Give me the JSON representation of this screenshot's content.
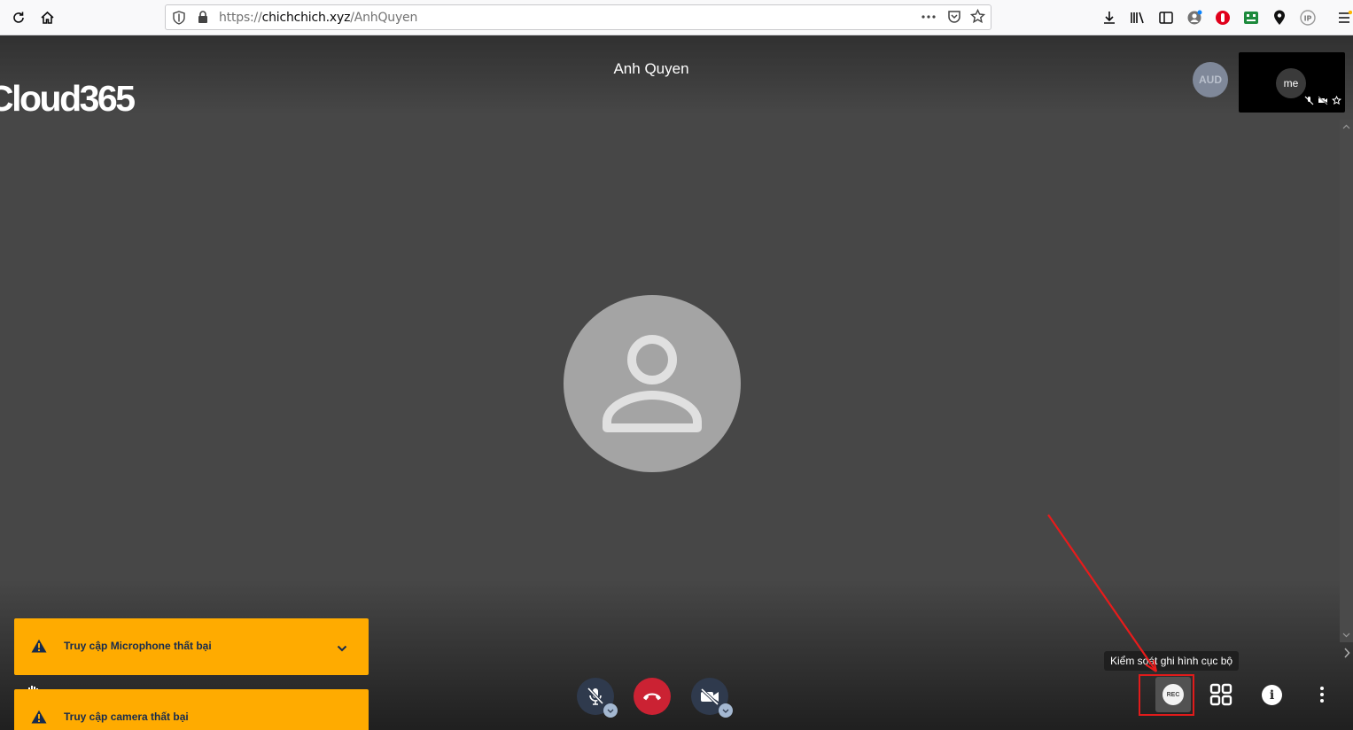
{
  "browser": {
    "url_scheme": "https://",
    "url_host": "chichchich.xyz",
    "url_path": "/AnhQuyen"
  },
  "meeting": {
    "title": "Anh Quyen",
    "logo_text": "Cloud365"
  },
  "participants": {
    "aud_badge": "AUD",
    "self_label": "me"
  },
  "notifications": [
    {
      "text": "Truy cập Microphone thất bại",
      "icon": "warning-icon"
    },
    {
      "text": "Truy cập camera thất bại",
      "icon": "warning-icon"
    }
  ],
  "controls": {
    "rec_label": "REC",
    "tooltip": "Kiểm soát ghi hình cục bộ",
    "info_label": "i"
  },
  "colors": {
    "stage_bg": "#474747",
    "notification": "#ffab00",
    "hangup": "#cb2233",
    "highlight": "#e01b1b"
  }
}
